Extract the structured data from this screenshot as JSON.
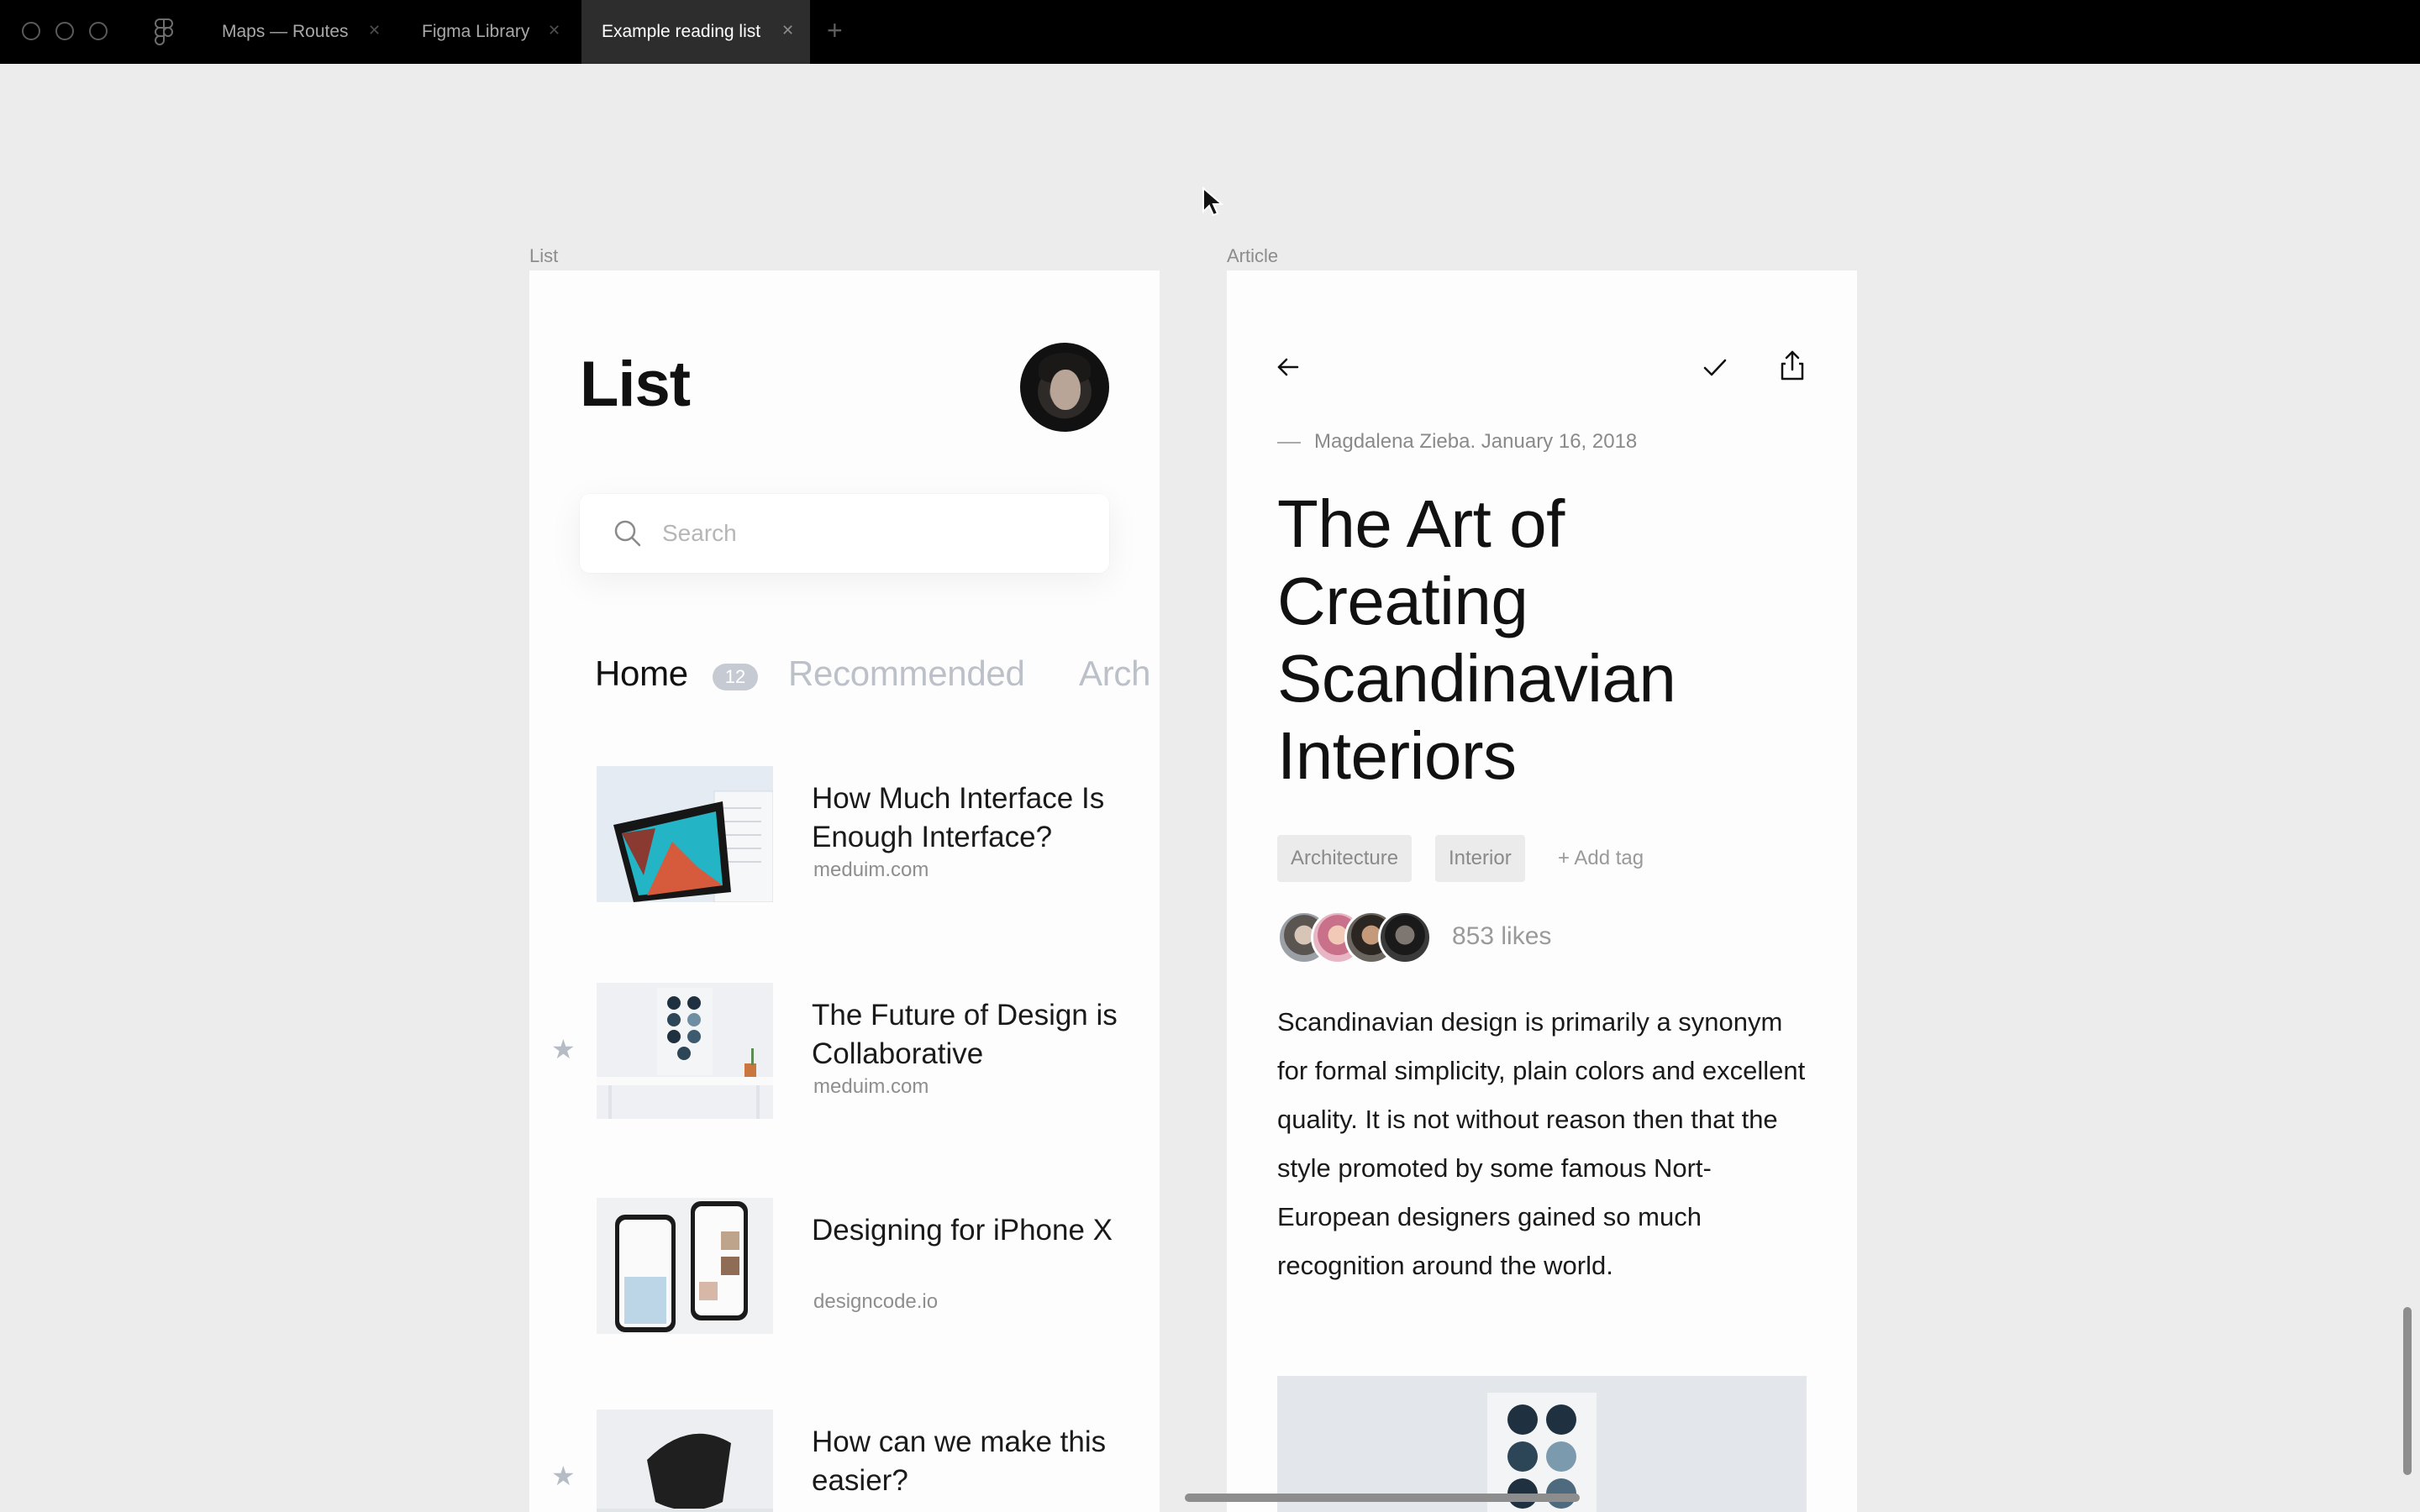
{
  "tabs": [
    {
      "label": "Maps — Routes"
    },
    {
      "label": "Figma Library"
    },
    {
      "label": "Example reading list"
    }
  ],
  "canvas": {
    "list_frame_label": "List",
    "article_frame_label": "Article"
  },
  "list": {
    "title": "List",
    "search_placeholder": "Search",
    "tabs": [
      {
        "label": "Home",
        "count": "12"
      },
      {
        "label": "Recommended"
      },
      {
        "label": "Arch"
      }
    ],
    "items": [
      {
        "title": "How Much Interface Is Enough Interface?",
        "source": "meduim.com",
        "starred": false
      },
      {
        "title": "The Future of Design is Collaborative",
        "source": "meduim.com",
        "starred": true
      },
      {
        "title": "Designing for iPhone X",
        "source": "designcode.io",
        "starred": false
      },
      {
        "title": "How can we make this easier?",
        "source": "",
        "starred": true
      }
    ]
  },
  "article": {
    "byline": "Magdalena Zieba. January 16, 2018",
    "title": "The Art of Creating Scandinavian Interiors",
    "tags": [
      "Architecture",
      "Interior"
    ],
    "add_tag": "+ Add tag",
    "likes": "853 likes",
    "body": "Scandinavian design is primarily a synonym for formal simplicity, plain colors and excellent quality. It is not without reason then that the style promoted by some famous Nort-European designers gained so much recognition around the world."
  },
  "colors": {
    "topbar": "#000000",
    "canvas": "#ececec",
    "frame": "#fdfdfd",
    "muted_tab": "#bcc0c8",
    "count_badge": "#c6cad2"
  }
}
